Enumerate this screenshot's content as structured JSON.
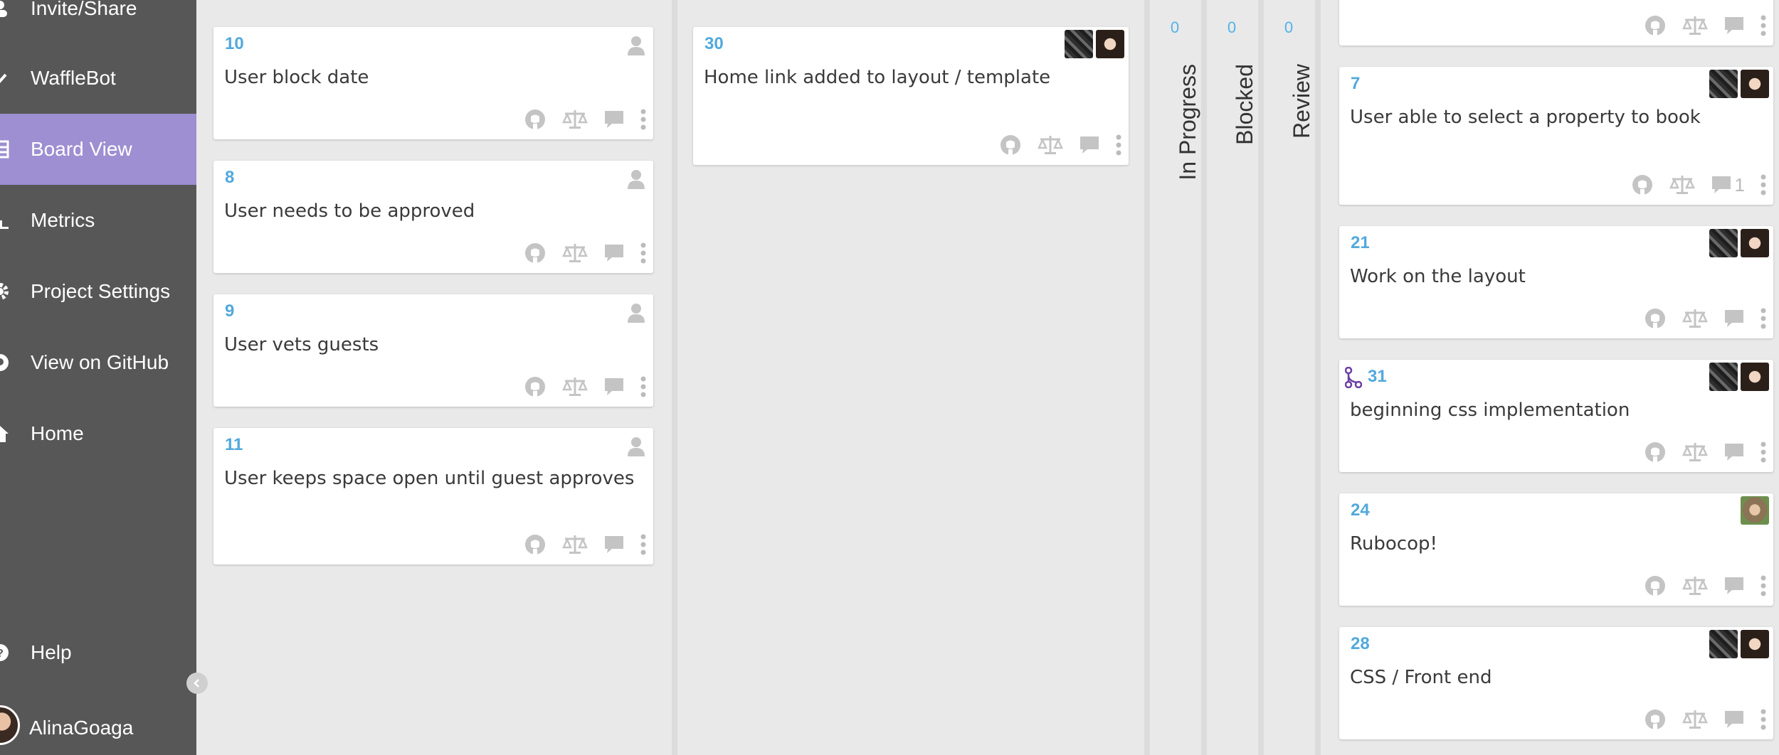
{
  "sidebar": {
    "items": [
      {
        "label": "Invite/Share",
        "icon": "users-icon"
      },
      {
        "label": "WaffleBot",
        "icon": "chevron-icon"
      },
      {
        "label": "Board View",
        "icon": "board-icon",
        "active": true
      },
      {
        "label": "Metrics",
        "icon": "bar-chart-icon"
      },
      {
        "label": "Project Settings",
        "icon": "gear-icon"
      },
      {
        "label": "View on GitHub",
        "icon": "github-icon"
      },
      {
        "label": "Home",
        "icon": "home-icon"
      }
    ],
    "help_label": "Help",
    "user_name": "AlinaGoaga",
    "active_color": "#9d8fd1"
  },
  "columns": {
    "col1": {
      "cards": [
        {
          "number": "10",
          "title": "User block date"
        },
        {
          "number": "8",
          "title": "User needs to be approved"
        },
        {
          "number": "9",
          "title": "User vets guests"
        },
        {
          "number": "11",
          "title": "User keeps space open until guest approves"
        }
      ]
    },
    "col2": {
      "cards": [
        {
          "number": "30",
          "title": "Home link added to layout / template"
        }
      ]
    },
    "in_progress": {
      "label": "In Progress",
      "count": "0"
    },
    "blocked": {
      "label": "Blocked",
      "count": "0"
    },
    "review": {
      "label": "Review",
      "count": "0"
    },
    "col3": {
      "cards": [
        {
          "number": "7",
          "title": "User able to select a property to book",
          "comments": "1"
        },
        {
          "number": "21",
          "title": "Work on the layout"
        },
        {
          "number": "31",
          "title": "beginning css implementation"
        },
        {
          "number": "24",
          "title": "Rubocop!"
        },
        {
          "number": "28",
          "title": "CSS / Front end"
        }
      ]
    }
  },
  "colors": {
    "accent": "#52a9dc",
    "count": "#52b3e8",
    "sidebar_bg": "#575757",
    "icon_gray": "#c4c4c4"
  }
}
